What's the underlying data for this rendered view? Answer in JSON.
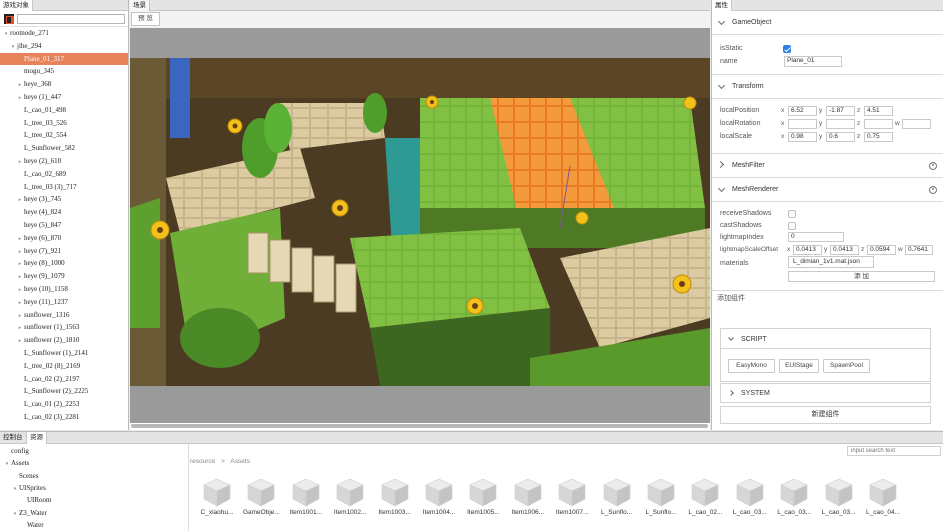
{
  "hierarchy": {
    "tab": "游戏对象",
    "search_placeholder": "",
    "items": [
      {
        "label": "rootnode_271",
        "indent": 0,
        "arrow": "▾"
      },
      {
        "label": "jihe_294",
        "indent": 1,
        "arrow": "▾"
      },
      {
        "label": "Plane_01_317",
        "indent": 2,
        "arrow": "",
        "selected": true
      },
      {
        "label": "mogu_345",
        "indent": 2,
        "arrow": ""
      },
      {
        "label": "heye_368",
        "indent": 2,
        "arrow": "▸"
      },
      {
        "label": "heye (1)_447",
        "indent": 2,
        "arrow": "▸"
      },
      {
        "label": "L_cao_01_498",
        "indent": 2,
        "arrow": ""
      },
      {
        "label": "L_tree_03_526",
        "indent": 2,
        "arrow": ""
      },
      {
        "label": "L_tree_02_554",
        "indent": 2,
        "arrow": ""
      },
      {
        "label": "L_Sunflower_582",
        "indent": 2,
        "arrow": ""
      },
      {
        "label": "heye (2)_610",
        "indent": 2,
        "arrow": "▸"
      },
      {
        "label": "L_cao_02_689",
        "indent": 2,
        "arrow": ""
      },
      {
        "label": "L_tree_03 (3)_717",
        "indent": 2,
        "arrow": ""
      },
      {
        "label": "heye (3)_745",
        "indent": 2,
        "arrow": "▸"
      },
      {
        "label": "heye (4)_824",
        "indent": 2,
        "arrow": ""
      },
      {
        "label": "heye (5)_847",
        "indent": 2,
        "arrow": ""
      },
      {
        "label": "heye (6)_870",
        "indent": 2,
        "arrow": "▸"
      },
      {
        "label": "heye (7)_921",
        "indent": 2,
        "arrow": "▸"
      },
      {
        "label": "heye (8)_1000",
        "indent": 2,
        "arrow": "▸"
      },
      {
        "label": "heye (9)_1079",
        "indent": 2,
        "arrow": "▸"
      },
      {
        "label": "heye (10)_1158",
        "indent": 2,
        "arrow": "▸"
      },
      {
        "label": "heye (11)_1237",
        "indent": 2,
        "arrow": "▸"
      },
      {
        "label": "sunflower_1316",
        "indent": 2,
        "arrow": "▸"
      },
      {
        "label": "sunflower (1)_1563",
        "indent": 2,
        "arrow": "▸"
      },
      {
        "label": "sunflower (2)_1810",
        "indent": 2,
        "arrow": "▸"
      },
      {
        "label": "L_Sunflower (1)_2141",
        "indent": 2,
        "arrow": ""
      },
      {
        "label": "L_tree_02 (8)_2169",
        "indent": 2,
        "arrow": ""
      },
      {
        "label": "L_cao_02 (2)_2197",
        "indent": 2,
        "arrow": ""
      },
      {
        "label": "L_Sunflower (2)_2225",
        "indent": 2,
        "arrow": ""
      },
      {
        "label": "L_cao_01 (2)_2253",
        "indent": 2,
        "arrow": ""
      },
      {
        "label": "L_cao_02 (3)_2281",
        "indent": 2,
        "arrow": ""
      }
    ]
  },
  "scene": {
    "tab": "场景",
    "preview_label": "预 览"
  },
  "properties": {
    "tab": "属性",
    "gameobject": {
      "title": "GameObject",
      "isstatic_label": "isStatic",
      "isstatic": true,
      "name_label": "name",
      "name_value": "Plane_01"
    },
    "transform": {
      "title": "Transform",
      "position_label": "localPosition",
      "rotation_label": "localRotation",
      "scale_label": "localScale",
      "position": {
        "x": "6.52",
        "y": "-1.87",
        "z": "4.51"
      },
      "rotation": {
        "x": "",
        "y": "",
        "z": "",
        "w": ""
      },
      "scale": {
        "x": "0.98",
        "y": "0.6",
        "z": "0.75"
      }
    },
    "meshfilter": {
      "title": "MeshFilter"
    },
    "meshrenderer": {
      "title": "MeshRenderer",
      "receive_label": "receiveShadows",
      "cast_label": "castShadows",
      "lmindex_label": "lightmapIndex",
      "lmindex_value": "0",
      "lmscale_label": "lightmapScaleOffset",
      "lmscale": {
        "x": "0.0413",
        "y": "0.0413",
        "z": "0.0594",
        "w": "0.7641"
      },
      "materials_label": "materials",
      "material_value": "L_dimian_1v1.mat.json",
      "add_label": "添 加"
    },
    "addcomp": {
      "title": "添加组件",
      "script_label": "SCRIPT",
      "script_buttons": [
        "EasyMono",
        "EUIStage",
        "SpawnPool"
      ],
      "system_label": "SYSTEM",
      "new_button": "新建组件"
    }
  },
  "bottom": {
    "tabs": [
      "控制台",
      "资源"
    ],
    "tree": [
      {
        "label": "config",
        "arrow": "",
        "indent": 0
      },
      {
        "label": "Assets",
        "arrow": "▾",
        "indent": 0
      },
      {
        "label": "Scenes",
        "arrow": "",
        "indent": 1
      },
      {
        "label": "UISprites",
        "arrow": "▾",
        "indent": 1
      },
      {
        "label": "UIRoom",
        "arrow": "",
        "indent": 2
      },
      {
        "label": "Z3_Water",
        "arrow": "▾",
        "indent": 1
      },
      {
        "label": "Water",
        "arrow": "",
        "indent": 2
      }
    ],
    "search_placeholder": "input search text",
    "breadcrumb": {
      "root": "resource",
      "sep": ">",
      "current": "Assets"
    },
    "assets": [
      "C_xiaohu...",
      "GameObje...",
      "Item1001...",
      "Item1002...",
      "Item1003...",
      "Item1004...",
      "Item1005...",
      "Item1006...",
      "Item1007...",
      "L_Sunflo...",
      "L_Sunflo...",
      "L_cao_02...",
      "L_cao_03...",
      "L_cao_03...",
      "L_cao_03...",
      "L_cao_04..."
    ]
  },
  "colors": {
    "selection": "#e8825a",
    "accent": "#2f7fe0",
    "grass": "#7ab23a",
    "path_orange": "#f08a2a"
  }
}
